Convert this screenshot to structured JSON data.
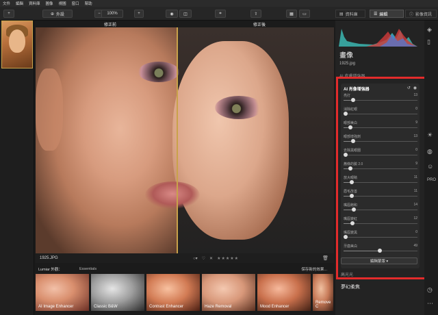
{
  "menu": [
    "文件",
    "編輯",
    "資料庫",
    "圖像",
    "視圖",
    "窗口",
    "幫助"
  ],
  "toolbar": {
    "plus": "+",
    "import_label": "外設",
    "zoom_minus": "−",
    "zoom_value": "100%",
    "zoom_plus": "+",
    "tabs": [
      {
        "label": "資料庫"
      },
      {
        "label": "編輯"
      },
      {
        "label": "影像資訊"
      }
    ]
  },
  "viewer": {
    "before_label": "修正前",
    "after_label": "修正後"
  },
  "status": {
    "filename": "1925.JPG",
    "reject": "✕",
    "stars": "★★★★★"
  },
  "looks": {
    "title": "Lumiar 外觀：",
    "category": "Essentials",
    "save": "保存新的效果...",
    "items": [
      {
        "name": "AI Image Enhancer"
      },
      {
        "name": "Classic B&W"
      },
      {
        "name": "Contrast Enhancer"
      },
      {
        "name": "Haze Removal"
      },
      {
        "name": "Mood Enhancer"
      },
      {
        "name": "Remove C"
      }
    ]
  },
  "panel": {
    "title": "畫像",
    "file": "1925.jpg",
    "faded": "AI 皮膚增強器",
    "enhancer_title": "AI 肖像增強器",
    "edit_mask": "編輯蒙版 ▾",
    "next_section": "高光光",
    "next_title": "夢幻柔焦",
    "sliders": [
      {
        "label": "亮打",
        "value": 13
      },
      {
        "label": "消除紅眼",
        "value": 0
      },
      {
        "label": "眼部美白",
        "value": 9
      },
      {
        "label": "眼部增強劑",
        "value": 13
      },
      {
        "label": "去除黑眼圈",
        "value": 0
      },
      {
        "label": "蕎條的臉 2.0",
        "value": 9
      },
      {
        "label": "放大眼睛",
        "value": 11
      },
      {
        "label": "眉毛改善",
        "value": 11
      },
      {
        "label": "嘴唇飽和",
        "value": 14
      },
      {
        "label": "嘴唇變紅",
        "value": 12
      },
      {
        "label": "嘴唇變黑",
        "value": 0
      },
      {
        "label": "牙齒美白",
        "value": 49
      }
    ]
  },
  "colors": {
    "accent_red": "#e32b2b",
    "split_gold": "#c9a24a"
  }
}
